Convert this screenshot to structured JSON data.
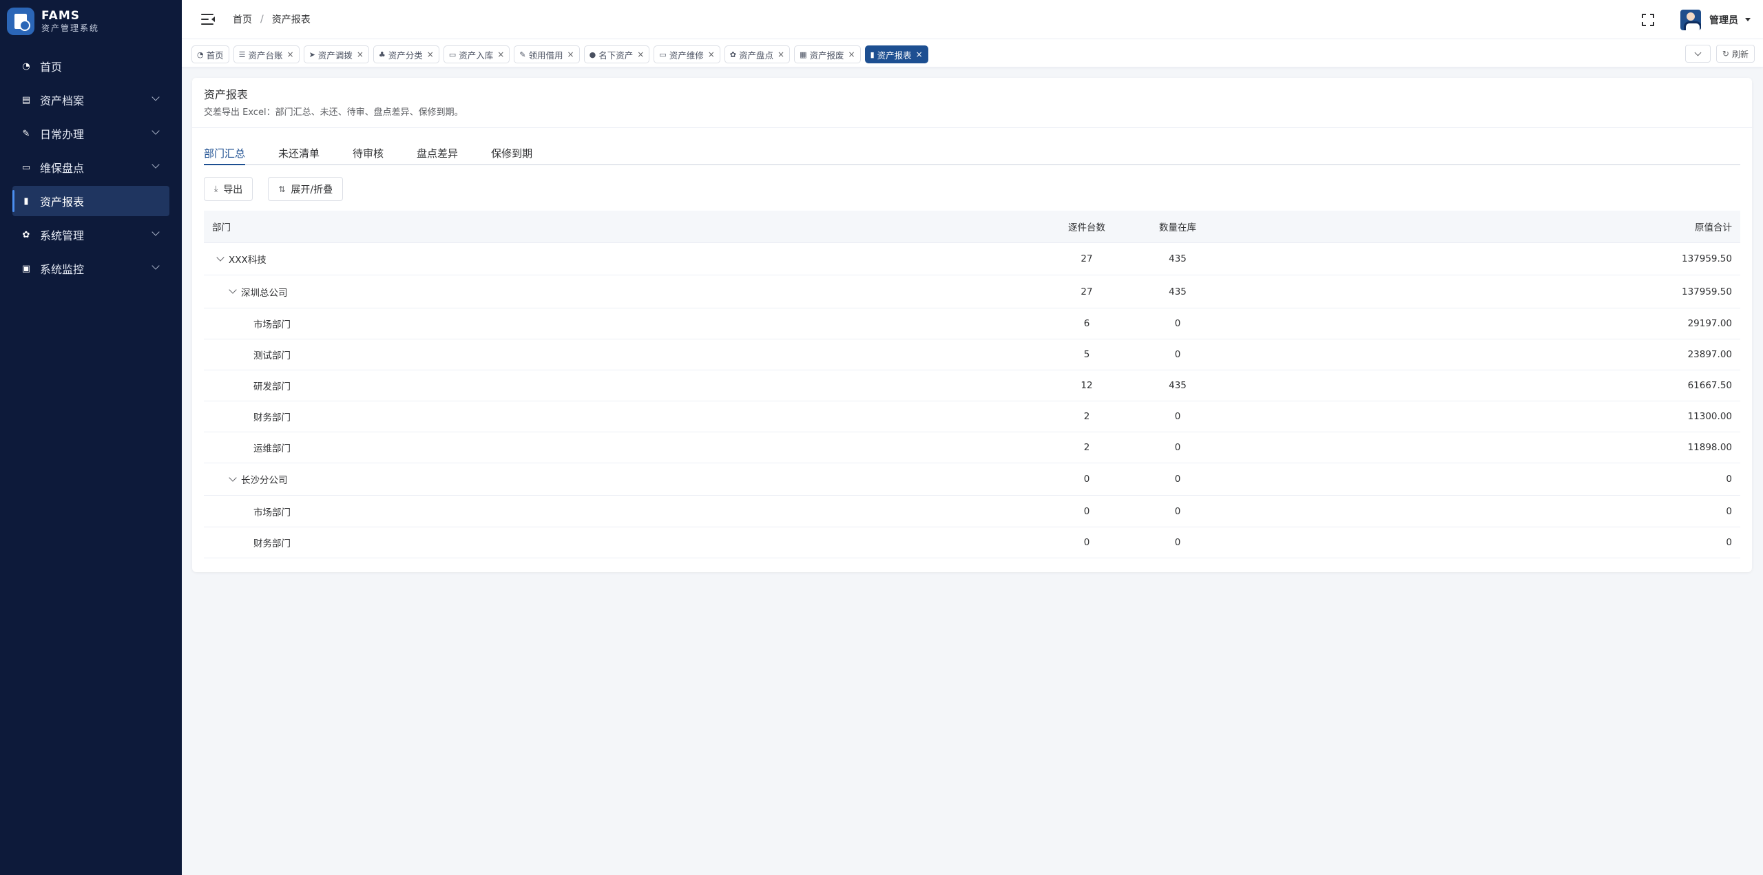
{
  "brand": {
    "name": "FAMS",
    "subtitle": "资产管理系统"
  },
  "sidebar": {
    "items": [
      {
        "label": "首页",
        "icon": "dashboard-icon"
      },
      {
        "label": "资产档案",
        "icon": "file-icon"
      },
      {
        "label": "日常办理",
        "icon": "edit-icon"
      },
      {
        "label": "维保盘点",
        "icon": "box-icon"
      },
      {
        "label": "资产报表",
        "icon": "chart-icon",
        "active": true
      },
      {
        "label": "系统管理",
        "icon": "gear-icon"
      },
      {
        "label": "系统监控",
        "icon": "monitor-icon"
      }
    ]
  },
  "header": {
    "breadcrumb": {
      "home": "首页",
      "separator": "/",
      "current": "资产报表"
    },
    "user": {
      "name": "管理员"
    }
  },
  "tags": [
    {
      "label": "首页",
      "closable": false
    },
    {
      "label": "资产台账",
      "closable": true
    },
    {
      "label": "资产调拨",
      "closable": true
    },
    {
      "label": "资产分类",
      "closable": true
    },
    {
      "label": "资产入库",
      "closable": true
    },
    {
      "label": "领用借用",
      "closable": true
    },
    {
      "label": "名下资产",
      "closable": true
    },
    {
      "label": "资产维修",
      "closable": true
    },
    {
      "label": "资产盘点",
      "closable": true
    },
    {
      "label": "资产报废",
      "closable": true
    },
    {
      "label": "资产报表",
      "closable": true,
      "active": true
    }
  ],
  "tags_tools": {
    "refresh": "刷新"
  },
  "card": {
    "title": "资产报表",
    "subtitle": "交差导出 Excel：部门汇总、未还、待审、盘点差异、保修到期。"
  },
  "tabs": [
    "部门汇总",
    "未还清单",
    "待审核",
    "盘点差异",
    "保修到期"
  ],
  "toolbar": {
    "export": "导出",
    "expand": "展开/折叠"
  },
  "table": {
    "headers": {
      "dept": "部门",
      "count": "逐件台数",
      "qty": "数量在库",
      "value": "原值合计"
    },
    "rows": [
      {
        "dept": "XXX科技",
        "count": "27",
        "qty": "435",
        "value": "137959.50"
      },
      {
        "dept": "深圳总公司",
        "count": "27",
        "qty": "435",
        "value": "137959.50"
      },
      {
        "dept": "市场部门",
        "count": "6",
        "qty": "0",
        "value": "29197.00"
      },
      {
        "dept": "测试部门",
        "count": "5",
        "qty": "0",
        "value": "23897.00"
      },
      {
        "dept": "研发部门",
        "count": "12",
        "qty": "435",
        "value": "61667.50"
      },
      {
        "dept": "财务部门",
        "count": "2",
        "qty": "0",
        "value": "11300.00"
      },
      {
        "dept": "运维部门",
        "count": "2",
        "qty": "0",
        "value": "11898.00"
      },
      {
        "dept": "长沙分公司",
        "count": "0",
        "qty": "0",
        "value": "0"
      },
      {
        "dept": "市场部门",
        "count": "0",
        "qty": "0",
        "value": "0"
      },
      {
        "dept": "财务部门",
        "count": "0",
        "qty": "0",
        "value": "0"
      }
    ]
  },
  "colors": {
    "sidebar_bg": "#0d1a3a",
    "accent": "#1d4f91",
    "page_bg": "#f4f6f9"
  }
}
